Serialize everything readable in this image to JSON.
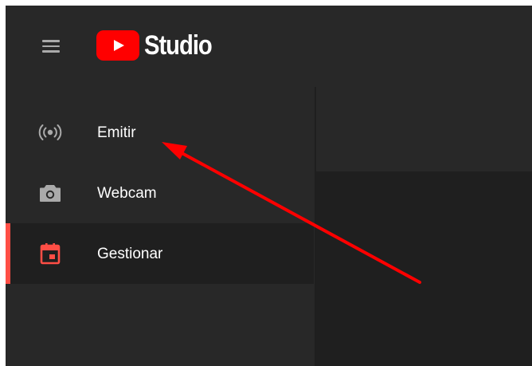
{
  "app": {
    "logo_text": "Studio"
  },
  "sidebar": {
    "items": [
      {
        "label": "Emitir",
        "icon": "broadcast-icon",
        "active": false
      },
      {
        "label": "Webcam",
        "icon": "camera-icon",
        "active": false
      },
      {
        "label": "Gestionar",
        "icon": "calendar-icon",
        "active": true
      }
    ]
  },
  "colors": {
    "background": "#282828",
    "active_background": "#1f1f1f",
    "accent": "#ff4e45",
    "brand_red": "#ff0000",
    "annotation_arrow": "#ff0000"
  }
}
